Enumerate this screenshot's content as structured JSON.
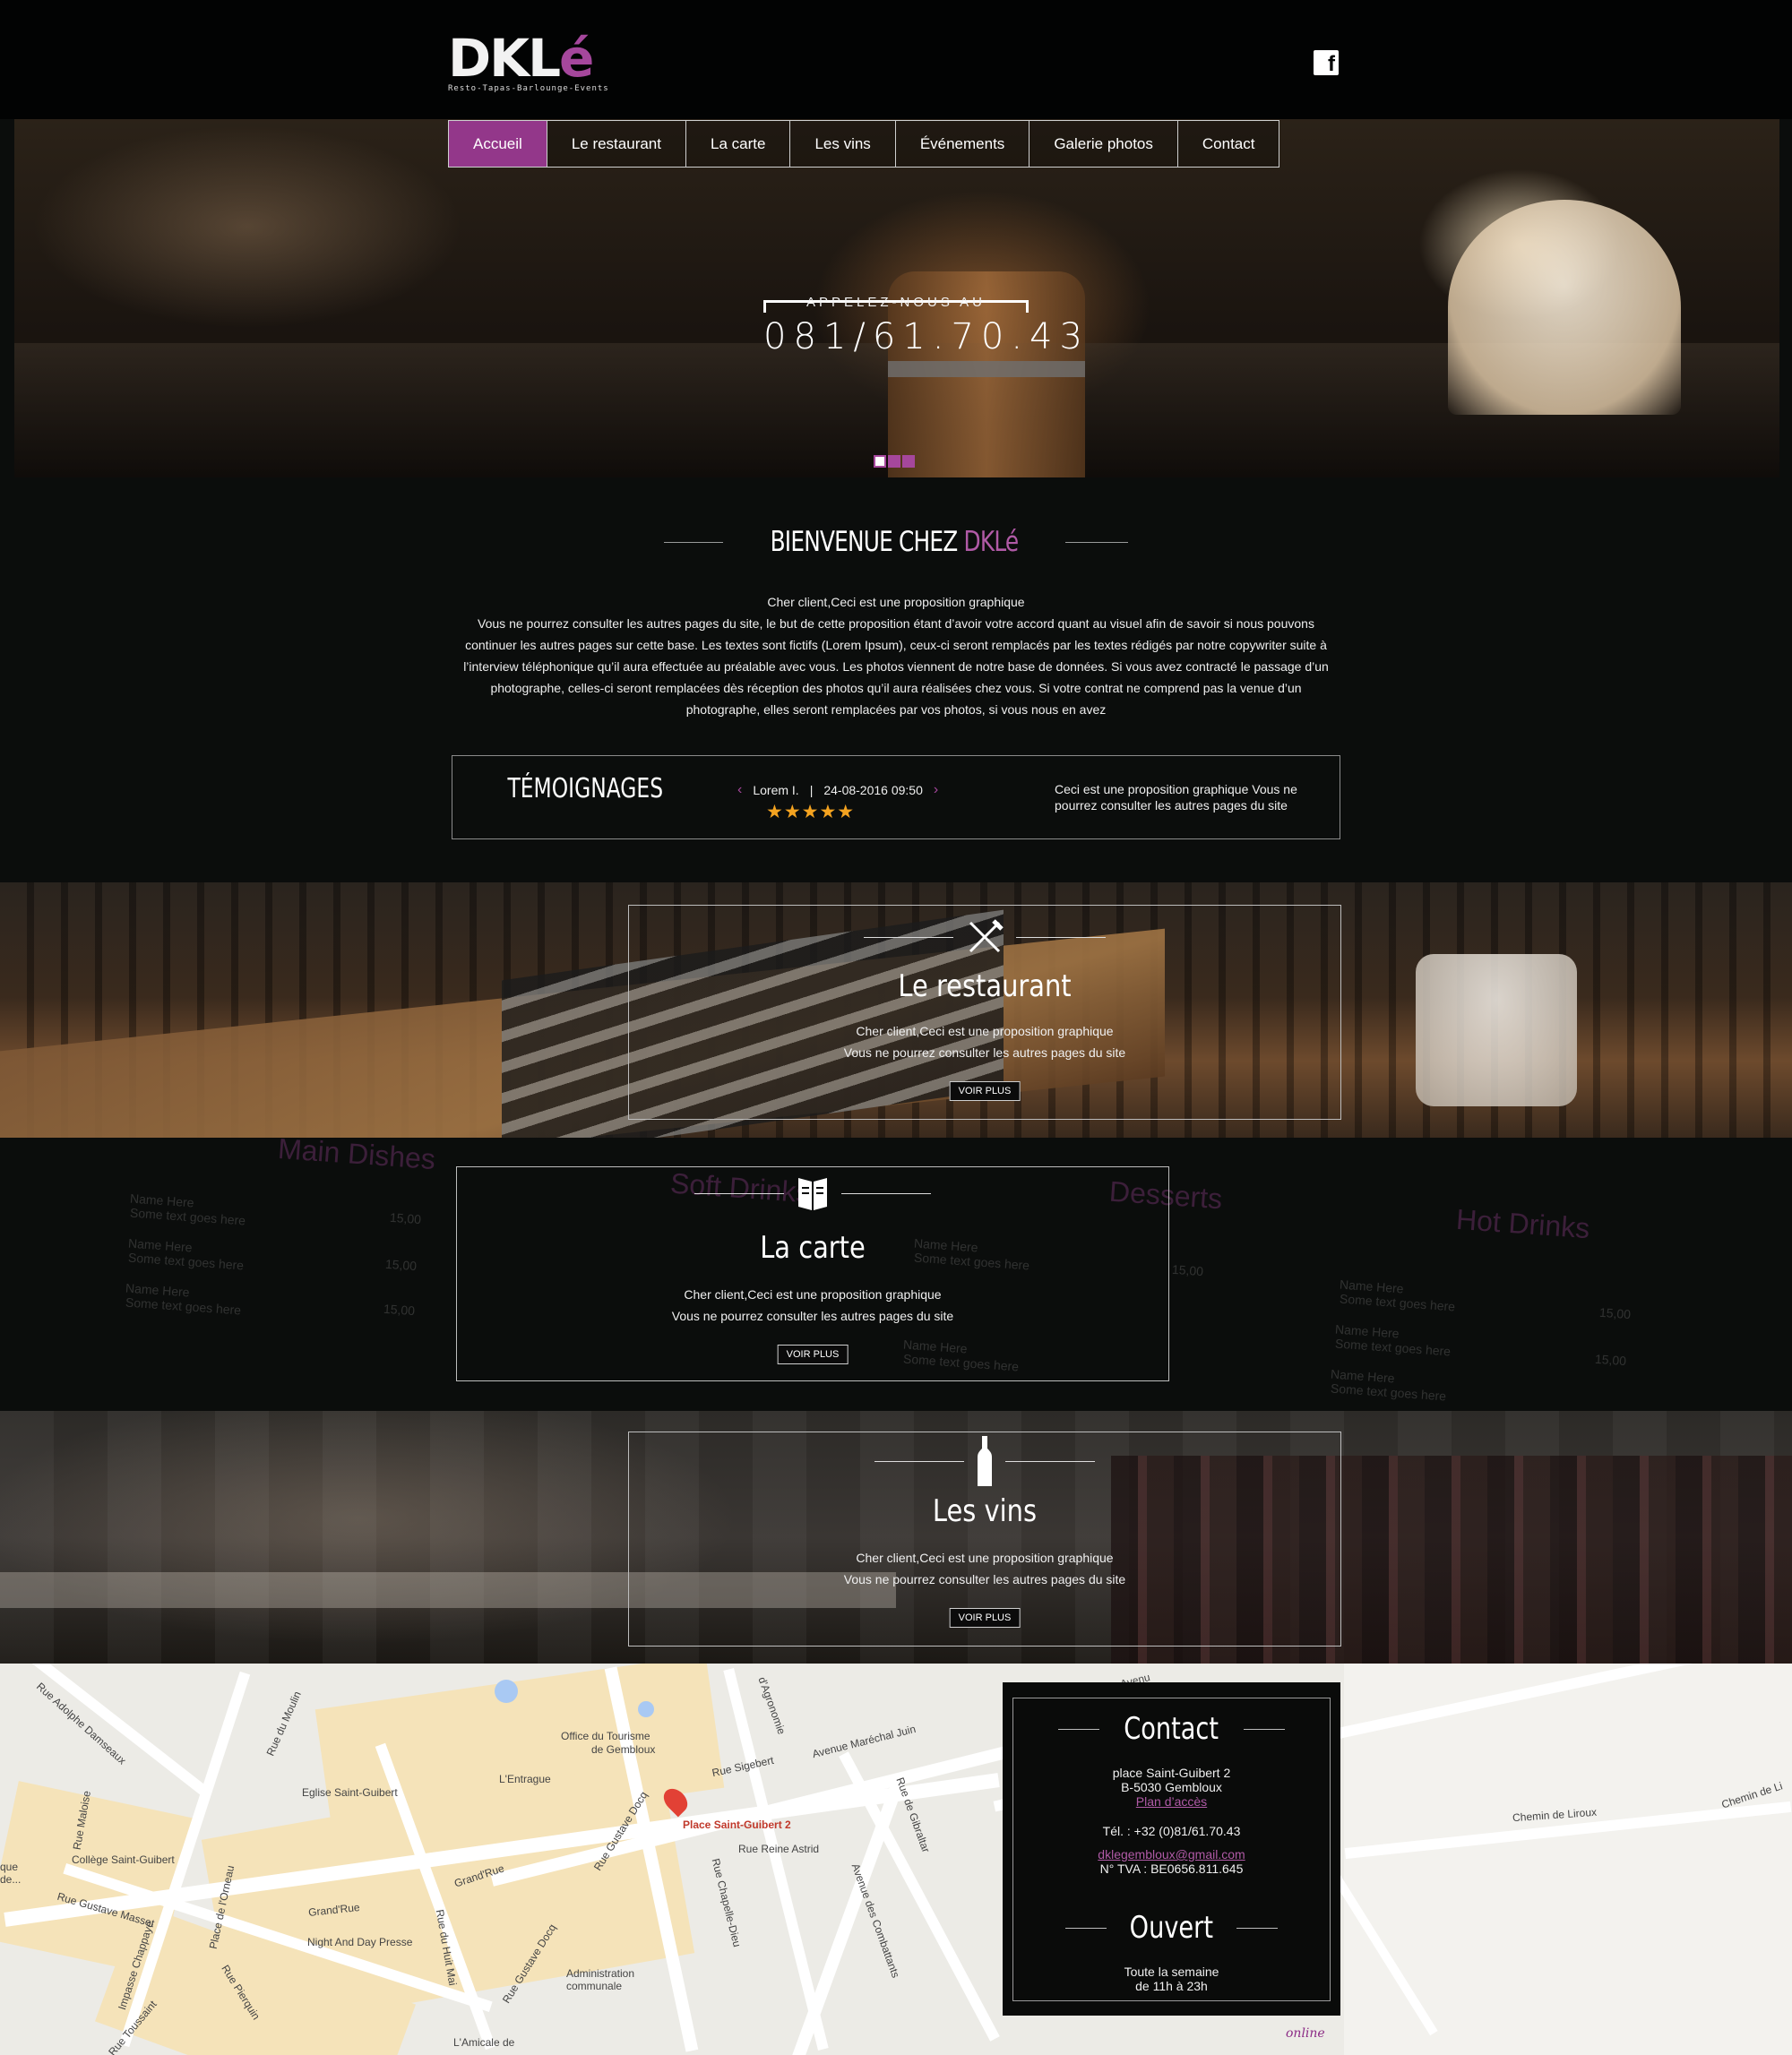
{
  "header": {
    "logo_text_main": "DKL",
    "logo_text_accent": "é",
    "logo_tagline": "Resto-Tapas-Barlounge-Events",
    "social": {
      "facebook_icon": "facebook-icon",
      "facebook_glyph": "f"
    }
  },
  "nav": {
    "items": [
      {
        "label": "Accueil",
        "active": true
      },
      {
        "label": "Le restaurant"
      },
      {
        "label": "La carte"
      },
      {
        "label": "Les vins"
      },
      {
        "label": "Événements"
      },
      {
        "label": "Galerie photos"
      },
      {
        "label": "Contact"
      }
    ]
  },
  "hero": {
    "call_label": "APPELEZ-NOUS AU",
    "phone": "081/61.70.43",
    "slides": 3,
    "active_slide": 1
  },
  "welcome": {
    "title": "BIENVENUE CHEZ",
    "title_accent": "DKLé",
    "paragraph_1": "Cher client,Ceci est  une proposition graphique",
    "paragraph_2": "Vous ne pourrez consulter les autres pages du site, le but de cette proposition étant d’avoir votre accord quant au visuel afin de savoir si nous pouvons continuer les autres pages sur cette base. Les textes sont fictifs (Lorem Ipsum), ceux-ci seront remplacés par les textes rédigés par notre copywriter suite à l’interview téléphonique qu’il aura effectuée au préalable avec vous. Les photos viennent de notre base de données. Si vous avez contracté le passage d’un photographe, celles-ci seront remplacées dès réception des photos qu’il aura réalisées chez vous. Si votre contrat ne comprend pas la venue d’un photographe, elles seront remplacées par vos photos, si vous nous en avez"
  },
  "testimonials": {
    "title": "TÉMOIGNAGES",
    "prev_glyph": "‹",
    "next_glyph": "›",
    "author": "Lorem I.",
    "separator": "|",
    "date": "24-08-2016 09:50",
    "rating": 5,
    "stars": "★★★★★",
    "quote": "Ceci est une proposition graphique Vous ne pourrez consulter les autres pages du site"
  },
  "features": {
    "restaurant": {
      "icon": "fork-knife-icon",
      "title": "Le restaurant",
      "text_1": "Cher client,Ceci est  une proposition graphique",
      "text_2": "Vous ne pourrez consulter les autres pages du site",
      "button": "VOIR PLUS"
    },
    "carte": {
      "icon": "menu-book-icon",
      "title": "La carte",
      "text_1": "Cher client,Ceci est  une proposition graphique",
      "text_2": "Vous ne pourrez consulter les autres pages du site",
      "button": "VOIR PLUS"
    },
    "vins": {
      "icon": "wine-bottle-icon",
      "title": "Les vins",
      "text_1": "Cher client,Ceci est  une proposition graphique",
      "text_2": "Vous ne pourrez consulter les autres pages du site",
      "button": "VOIR PLUS"
    }
  },
  "menu_background": {
    "main_dishes": "Main Dishes",
    "soft_drinks": "Soft Drinks",
    "desserts": "Desserts",
    "hot_drinks": "Hot Drinks",
    "item_name": "Name Here",
    "item_desc": "Some text goes here",
    "item_price": "15,00"
  },
  "map": {
    "pin_label": "Place Saint-Guibert 2",
    "labels": {
      "office": "Office du Tourisme",
      "office_2": "de Gembloux",
      "entrague": "L'Entrague",
      "eglise": "Eglise Saint-Guibert",
      "college": "Collège Saint-Guibert",
      "night_day": "Night And Day Presse",
      "administration": "Administration",
      "administration_2": "communale",
      "amicale": "L'Amicale de",
      "rue_sigebert": "Rue Sigebert",
      "avenue_jean": "Avenue Maréchal Juin",
      "rue_reine": "Rue Reine Astrid",
      "rue_gibraltar": "Rue de Gibraltar",
      "grand_rue": "Grand'Rue",
      "grand_rue_2": "Grand'Rue",
      "rue_gustave": "Rue Gustave Masset",
      "rue_chapelle": "Rue Chapelle-Dieu",
      "avenue_combattants": "Avenue des Combattants",
      "chemin_liroux": "Chemin de Liroux",
      "chemin_liroux_2": "Chemin de Li",
      "rue_adolphe": "Rue Adolphe Damseaux",
      "rue_moulin": "Rue du Moulin",
      "rue_agronomie": "d'Agronomie",
      "rue_huit_mai": "Rue du Huit Mai",
      "rue_docq": "Rue Gustave Docq",
      "rue_docq_2": "Rue Gustave Docq",
      "rue_pierquin": "Rue Pierquin",
      "impasse": "Impasse Chappaye",
      "place_orneau": "Place de l'Orneau",
      "rue_toussaint": "Rue Toussaint",
      "rue_maloise": "Rue Maloise",
      "que_de": "que",
      "que_de_2": "de...",
      "avenue_short": "Avenu"
    }
  },
  "contact": {
    "title": "Contact",
    "address_1": "place Saint-Guibert 2",
    "address_2": "B-5030 Gembloux",
    "directions_link": "Plan d’accès",
    "phone": "Tél. : +32 (0)81/61.70.43",
    "email": "dklegembloux@gmail.com",
    "vat": "N° TVA : BE0656.811.645",
    "hours_title": "Ouvert",
    "hours_1": "Toute la semaine",
    "hours_2": "de 11h à 23h"
  },
  "footer_badge": "online",
  "colors": {
    "accent": "#a5479c",
    "nav_active": "#93378a",
    "background": "#0b0d0c",
    "star": "#f4a320"
  }
}
